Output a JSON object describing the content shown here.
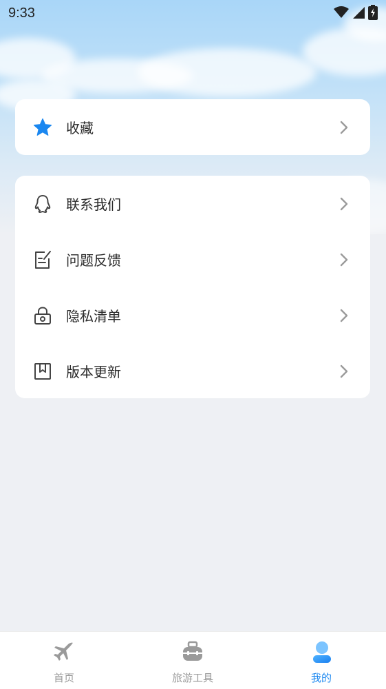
{
  "status_bar": {
    "time": "9:33"
  },
  "favorites_card": {
    "items": [
      {
        "label": "收藏",
        "icon": "star-icon"
      }
    ]
  },
  "menu_card": {
    "items": [
      {
        "label": "联系我们",
        "icon": "qq-penguin-icon"
      },
      {
        "label": "问题反馈",
        "icon": "edit-note-icon"
      },
      {
        "label": "隐私清单",
        "icon": "lock-icon"
      },
      {
        "label": "版本更新",
        "icon": "bookmark-book-icon"
      }
    ]
  },
  "tab_bar": {
    "tabs": [
      {
        "label": "首页",
        "icon": "airplane-icon",
        "active": false
      },
      {
        "label": "旅游工具",
        "icon": "suitcase-icon",
        "active": false
      },
      {
        "label": "我的",
        "icon": "user-icon",
        "active": true
      }
    ]
  },
  "colors": {
    "accent": "#1a87f0",
    "star": "#1a87f0",
    "inactive": "#9a9a9a"
  }
}
